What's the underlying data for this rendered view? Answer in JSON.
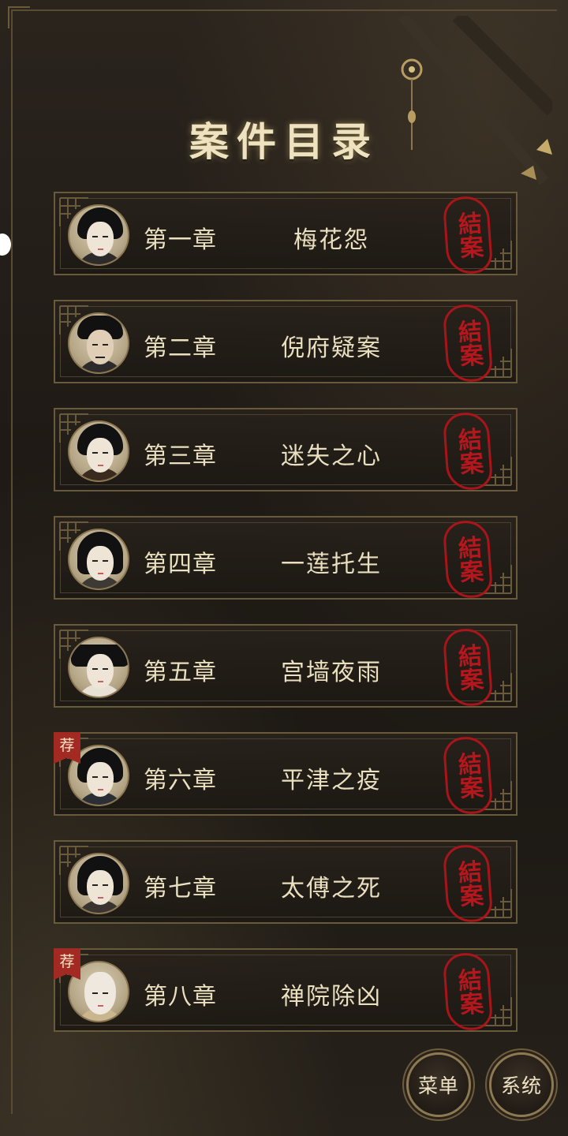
{
  "screen": {
    "title": "案件目录"
  },
  "chapters": [
    {
      "number": "第一章",
      "name": "梅花怨",
      "status": "結案",
      "recommended": false,
      "rec_label": ""
    },
    {
      "number": "第二章",
      "name": "倪府疑案",
      "status": "結案",
      "recommended": false,
      "rec_label": ""
    },
    {
      "number": "第三章",
      "name": "迷失之心",
      "status": "結案",
      "recommended": false,
      "rec_label": ""
    },
    {
      "number": "第四章",
      "name": "一莲托生",
      "status": "結案",
      "recommended": false,
      "rec_label": ""
    },
    {
      "number": "第五章",
      "name": "宫墙夜雨",
      "status": "結案",
      "recommended": false,
      "rec_label": ""
    },
    {
      "number": "第六章",
      "name": "平津之疫",
      "status": "結案",
      "recommended": true,
      "rec_label": "荐"
    },
    {
      "number": "第七章",
      "name": "太傅之死",
      "status": "結案",
      "recommended": false,
      "rec_label": ""
    },
    {
      "number": "第八章",
      "name": "禅院除凶",
      "status": "結案",
      "recommended": true,
      "rec_label": "荐"
    }
  ],
  "buttons": {
    "menu": "菜单",
    "system": "系统"
  },
  "colors": {
    "text": "#eadfbf",
    "seal": "#c3161d",
    "border": "#6a5a3c",
    "badge": "#a22a23"
  }
}
